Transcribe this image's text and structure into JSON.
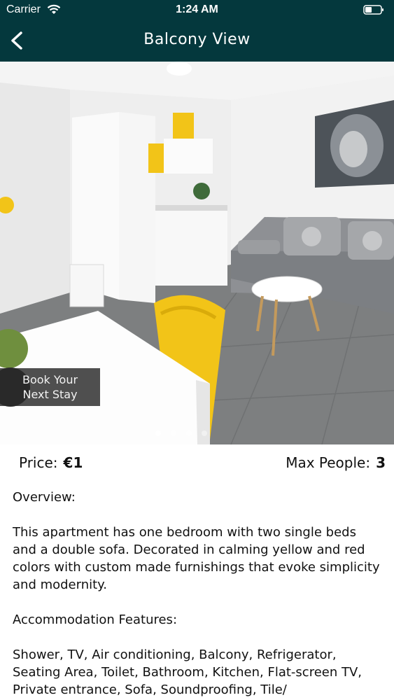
{
  "status_bar": {
    "carrier": "Carrier",
    "time": "1:24 AM"
  },
  "navbar": {
    "title": "Balcony View",
    "back_icon": "chevron-left-icon"
  },
  "gallery": {
    "book_button_line1": "Book Your",
    "book_button_line2": "Next Stay",
    "page_count": 4,
    "active_page": 1
  },
  "info": {
    "price_label": "Price:",
    "price_value": "€1",
    "max_people_label": "Max People:",
    "max_people_value": "3"
  },
  "description": {
    "overview_heading": "Overview:",
    "overview_text": "This apartment has one bedroom with two single beds and a double sofa. Decorated in calming yellow and red colors with custom made furnishings that evoke simplicity and modernity.",
    "features_heading": "Accommodation Features:",
    "features_text": "Shower, TV, Air conditioning, Balcony, Refrigerator, Seating Area, Toilet, Bathroom, Kitchen, Flat-screen TV, Private entrance, Sofa, Soundproofing, Tile/"
  },
  "colors": {
    "header_bg": "#04383d",
    "accent_yellow": "#f2c418"
  }
}
